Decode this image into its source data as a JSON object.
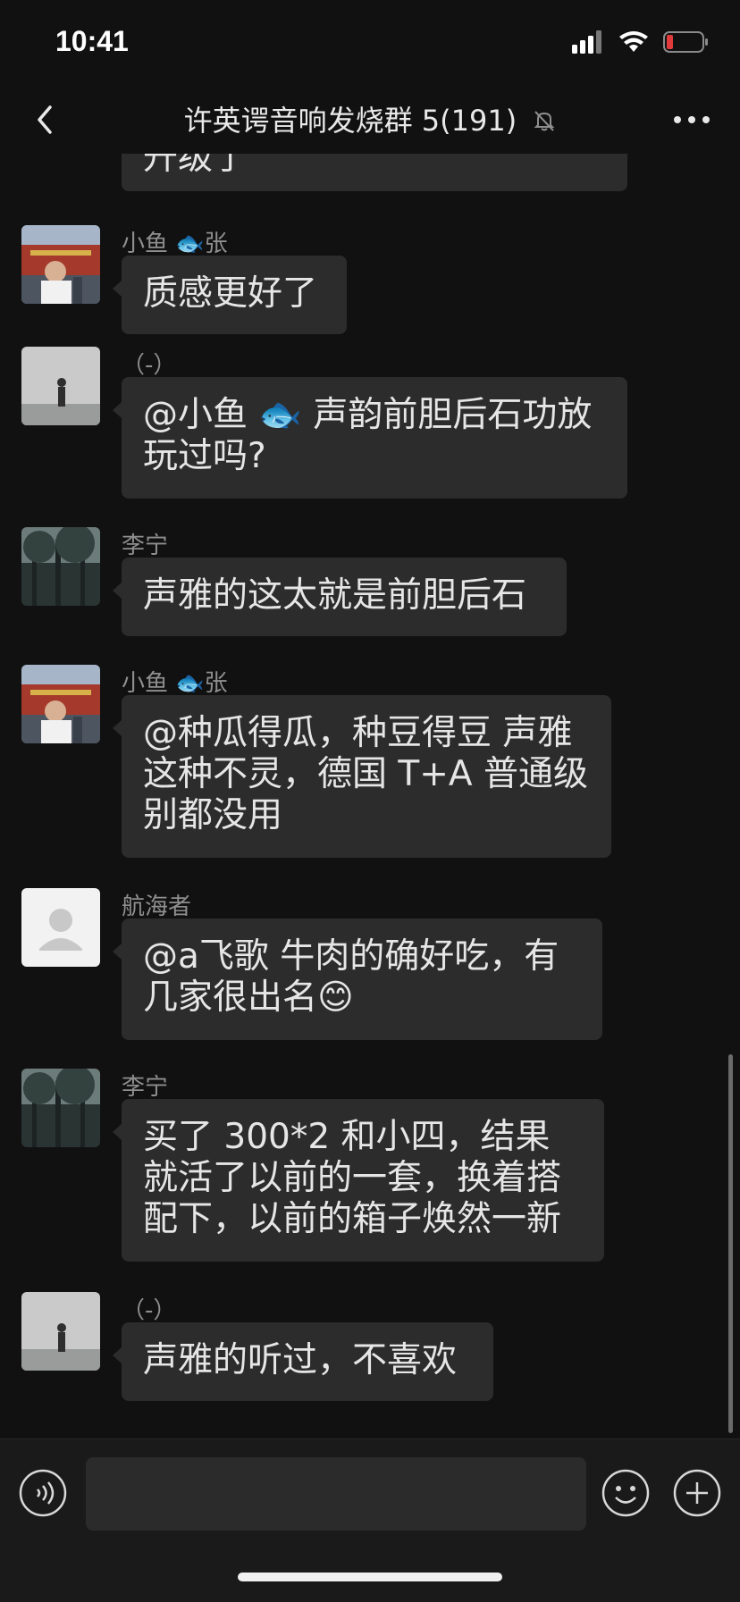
{
  "status": {
    "time": "10:41"
  },
  "header": {
    "title": "许英谔音响发烧群 5(191)"
  },
  "messages": [
    {
      "text": "升级了"
    },
    {
      "sender": "小鱼 🐟张",
      "text": "质感更好了"
    },
    {
      "sender": "（-）",
      "text": "@小鱼 🐟 声韵前胆后石功放玩过吗?"
    },
    {
      "sender": "李宁",
      "text": "声雅的这太就是前胆后石"
    },
    {
      "sender": "小鱼 🐟张",
      "text": "@种瓜得瓜，种豆得豆 声雅这种不灵，德国 T+A 普通级别都没用"
    },
    {
      "sender": "航海者",
      "text": "@a飞歌  牛肉的确好吃，有几家很出名😊"
    },
    {
      "sender": "李宁",
      "text": "买了 300*2 和小四，结果就活了以前的一套，换着搭配下，以前的箱子焕然一新"
    },
    {
      "sender": "（-）",
      "text": "声雅的听过，不喜欢"
    }
  ],
  "icons": {
    "back": "chevron-left-icon",
    "mute": "bell-off-icon",
    "more": "more-dots-icon",
    "voice": "voice-icon",
    "emoji": "emoji-icon",
    "plus": "plus-icon"
  },
  "colors": {
    "background": "#111111",
    "bubble": "#2c2c2c",
    "battery_low": "#e03a3a"
  }
}
